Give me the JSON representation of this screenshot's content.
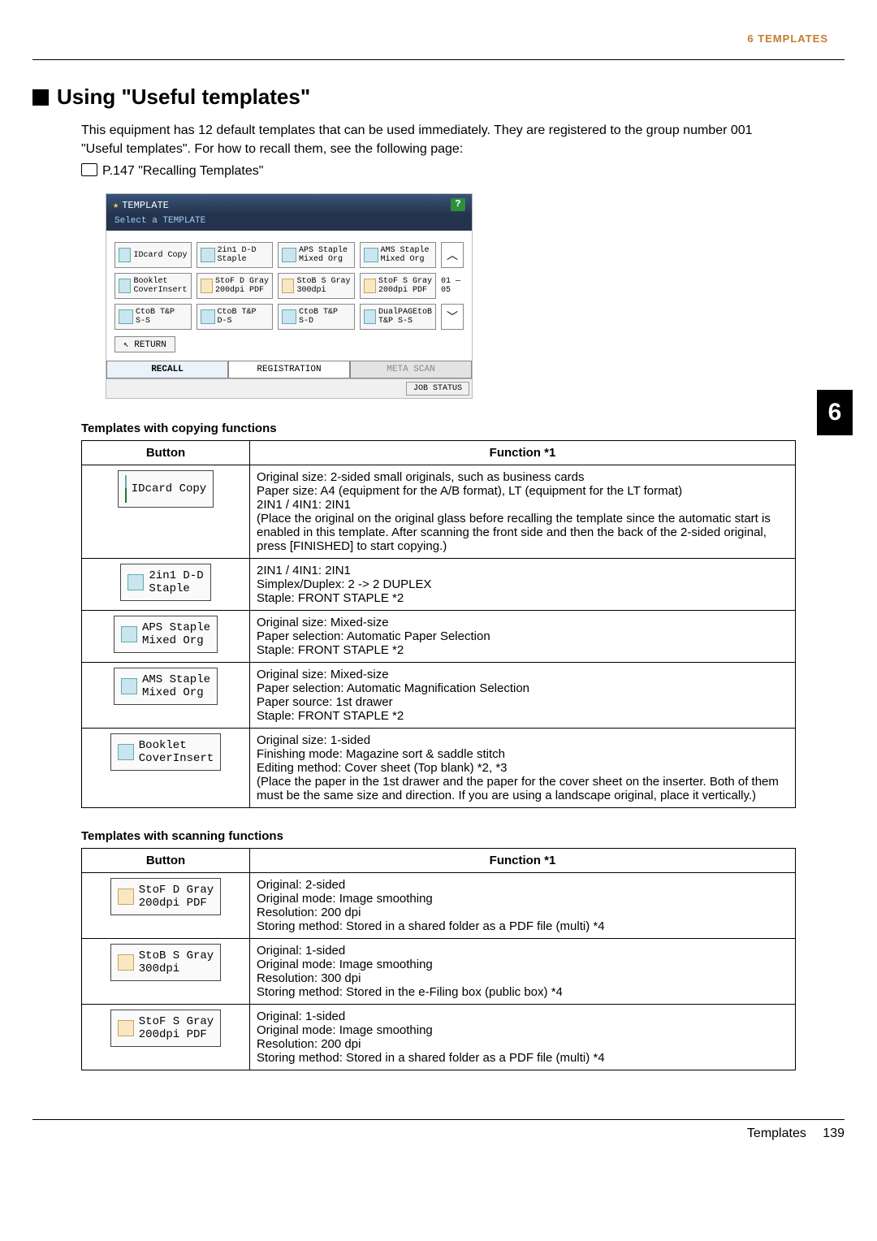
{
  "header": {
    "chapter": "6 TEMPLATES"
  },
  "sideTab": "6",
  "section_title": "Using \"Useful templates\"",
  "intro": "This equipment has 12 default templates that can be used immediately. They are registered to the group number 001 \"Useful templates\". For how to recall them, see the following page:",
  "pref": "P.147 \"Recalling Templates\"",
  "screenshot": {
    "title": "TEMPLATE",
    "subtitle": "Select a TEMPLATE",
    "help": "?",
    "page_indicator": "01\n—\n05",
    "templates": [
      "IDcard Copy",
      "2in1 D-D\nStaple",
      "APS Staple\nMixed Org",
      "AMS Staple\nMixed Org",
      "Booklet\nCoverInsert",
      "StoF D Gray\n200dpi PDF",
      "StoB S Gray\n300dpi",
      "StoF S Gray\n200dpi PDF",
      "CtoB T&P\nS-S",
      "CtoB T&P\nD-S",
      "CtoB T&P\nS-D",
      "DualPAGEtoB\nT&P S-S"
    ],
    "return": "RETURN",
    "tabs": [
      "RECALL",
      "REGISTRATION",
      "META SCAN"
    ],
    "jobstatus": "JOB STATUS"
  },
  "copying": {
    "caption": "Templates with copying functions",
    "header_button": "Button",
    "header_function": "Function *1",
    "rows": [
      {
        "btn": "IDcard Copy",
        "fn": "Original size: 2-sided small originals, such as business cards\nPaper size: A4 (equipment for the A/B format), LT (equipment for the LT format)\n2IN1 / 4IN1: 2IN1\n(Place the original on the original glass before recalling the template since the automatic start is enabled in this template. After scanning the front side and then the back of the 2-sided original, press [FINISHED] to start copying.)"
      },
      {
        "btn": "2in1 D-D\nStaple",
        "fn": "2IN1 / 4IN1: 2IN1\nSimplex/Duplex: 2 -> 2 DUPLEX\nStaple: FRONT STAPLE *2"
      },
      {
        "btn": "APS Staple\nMixed Org",
        "fn": "Original size: Mixed-size\nPaper selection: Automatic Paper Selection\nStaple: FRONT STAPLE *2"
      },
      {
        "btn": "AMS Staple\nMixed Org",
        "fn": "Original size: Mixed-size\nPaper selection: Automatic Magnification Selection\nPaper source: 1st drawer\nStaple: FRONT STAPLE *2"
      },
      {
        "btn": "Booklet\nCoverInsert",
        "fn": "Original size: 1-sided\nFinishing mode: Magazine sort & saddle stitch\nEditing method: Cover sheet (Top blank) *2, *3\n(Place the paper in the 1st drawer and the paper for the cover sheet on the inserter. Both of them must be the same size and direction. If you are using a landscape original, place it vertically.)"
      }
    ]
  },
  "scanning": {
    "caption": "Templates with scanning functions",
    "header_button": "Button",
    "header_function": "Function *1",
    "rows": [
      {
        "btn": "StoF D Gray\n200dpi PDF",
        "fn": "Original: 2-sided\nOriginal mode: Image smoothing\nResolution: 200 dpi\nStoring method: Stored in a shared folder as a PDF file (multi) *4"
      },
      {
        "btn": "StoB S Gray\n300dpi",
        "fn": "Original: 1-sided\nOriginal mode: Image smoothing\nResolution: 300 dpi\nStoring method: Stored in the e-Filing box (public box) *4"
      },
      {
        "btn": "StoF S Gray\n200dpi PDF",
        "fn": "Original: 1-sided\nOriginal mode: Image smoothing\nResolution: 200 dpi\nStoring method: Stored in a shared folder as a PDF file (multi) *4"
      }
    ]
  },
  "footer": {
    "label": "Templates",
    "page": "139"
  }
}
